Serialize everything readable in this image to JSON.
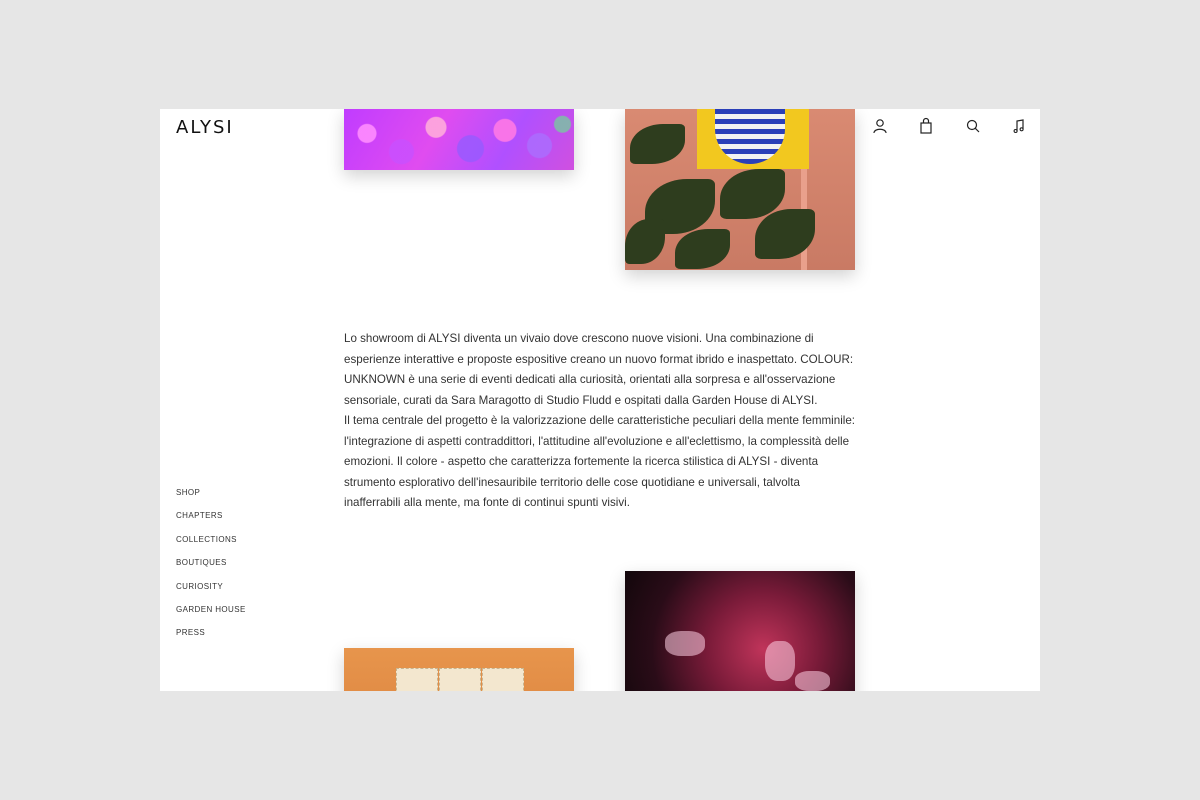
{
  "brand": {
    "logo": "ALYSI"
  },
  "nav": {
    "items": [
      "SHOP",
      "CHAPTERS",
      "COLLECTIONS",
      "BOUTIQUES",
      "CURIOSITY",
      "GARDEN HOUSE",
      "PRESS"
    ]
  },
  "header_icons": [
    "heart-icon",
    "user-icon",
    "bag-icon",
    "search-icon",
    "music-icon"
  ],
  "article": {
    "paragraph_1": "Lo showroom di ALYSI diventa un vivaio dove crescono nuove visioni. Una combinazione di esperienze interattive e proposte espositive creano un nuovo format ibrido e inaspettato. COLOUR: UNKNOWN è una serie di eventi dedicati alla curiosità, orientati alla sorpresa e all'osservazione sensoriale, curati da Sara Maragotto di Studio Fludd e ospitati dalla Garden House di ALYSI.",
    "paragraph_2": "Il tema centrale del progetto è la valorizzazione delle caratteristiche peculiari della mente femminile: l'integrazione di aspetti contraddittori, l'attitudine all'evoluzione e all'eclettismo, la complessità delle emozioni. Il colore - aspetto che caratterizza fortemente la ricerca stilistica di ALYSI - diventa strumento esplorativo dell'inesauribile territorio delle cose quotidiane e universali, talvolta inafferrabili alla mente, ma fonte di continui spunti visivi."
  },
  "colors": {
    "background": "#e6e6e6",
    "page": "#ffffff",
    "text": "#333333"
  }
}
